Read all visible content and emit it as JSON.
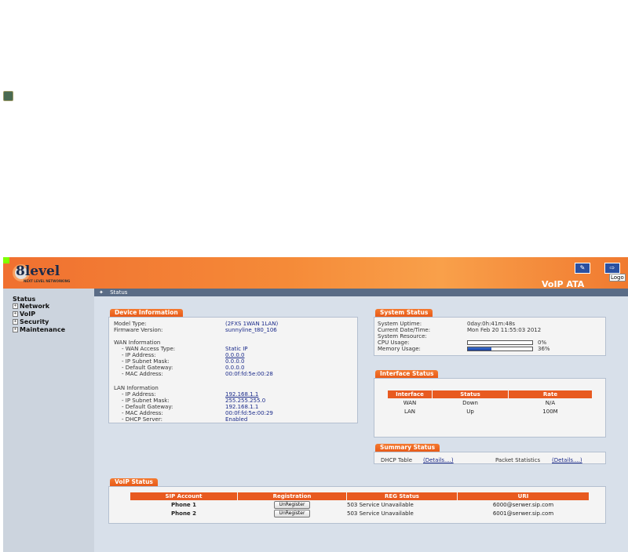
{
  "app": {
    "logo": "8level",
    "logo_sub": "NEXT LEVEL NETWORKING",
    "product": "VoIP ATA",
    "logout_tip": "Logo"
  },
  "breadcrumb": "Status",
  "sidebar": {
    "title": "Status",
    "items": [
      {
        "label": "Network",
        "icon": "+"
      },
      {
        "label": "VoIP",
        "icon": "+"
      },
      {
        "label": "Security",
        "icon": "+"
      },
      {
        "label": "Maintenance",
        "icon": "+"
      }
    ]
  },
  "device": {
    "tab": "Device Information",
    "model_label": "Model Type:",
    "model": "(2FXS 1WAN 1LAN)",
    "fw_label": "Firmware Version:",
    "fw": "sunnyline_t80_106",
    "wan_title": "WAN Information",
    "wan": [
      {
        "label": "- WAN Access Type:",
        "value": "Static IP",
        "link": false
      },
      {
        "label": "- IP Address:",
        "value": "0.0.0.0",
        "link": true
      },
      {
        "label": "- IP Subnet Mask:",
        "value": "0.0.0.0",
        "link": false
      },
      {
        "label": "- Default Gateway:",
        "value": "0.0.0.0",
        "link": false
      },
      {
        "label": "- MAC Address:",
        "value": "00:0f:fd:5e:00:28",
        "link": false
      }
    ],
    "lan_title": "LAN Information",
    "lan": [
      {
        "label": "- IP Address:",
        "value": "192.168.1.1",
        "link": true
      },
      {
        "label": "- IP Subnet Mask:",
        "value": "255.255.255.0",
        "link": false
      },
      {
        "label": "- Default Gateway:",
        "value": "192.168.1.1",
        "link": false
      },
      {
        "label": "- MAC Address:",
        "value": "00:0f:fd:5e:00:29",
        "link": false
      },
      {
        "label": "- DHCP Server:",
        "value": "Enabled",
        "link": false
      }
    ]
  },
  "system": {
    "tab": "System Status",
    "uptime_label": "System Uptime:",
    "uptime": "0day:0h:41m:48s",
    "date_label": "Current Date/Time:",
    "date": "Mon Feb 20 11:55:03 2012",
    "resource_label": "System Resource:",
    "cpu_label": "CPU Usage:",
    "cpu": "0%",
    "cpu_level": 0,
    "mem_label": "Memory Usage:",
    "mem": "36%",
    "mem_level": 36
  },
  "interface": {
    "tab": "Interface Status",
    "headers": [
      "Interface",
      "Status",
      "Rate"
    ],
    "rows": [
      [
        "WAN",
        "Down",
        "N/A"
      ],
      [
        "LAN",
        "Up",
        "100M"
      ]
    ]
  },
  "summary": {
    "tab": "Summary Status",
    "dhcp_label": "DHCP Table",
    "dhcp_link": "(Details....)",
    "packet_label": "Packet Statistics",
    "packet_link": "(Details....)"
  },
  "voip": {
    "tab": "VoIP Status",
    "headers": [
      "SIP Account",
      "Registration",
      "REG Status",
      "URI"
    ],
    "rows": [
      {
        "account": "Phone 1",
        "button": "UnRegister",
        "status": "503 Service Unavailable",
        "uri": "6000@serwer.sip.com"
      },
      {
        "account": "Phone 2",
        "button": "UnRegister",
        "status": "503 Service Unavailable",
        "uri": "6001@serwer.sip.com"
      }
    ]
  }
}
